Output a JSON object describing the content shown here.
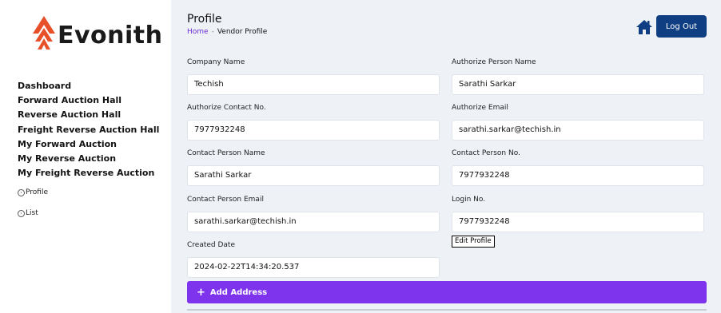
{
  "brand": {
    "name": "Evonith",
    "accent": "#e8502a"
  },
  "sidebar": {
    "items": [
      {
        "label": "Dashboard"
      },
      {
        "label": "Forward Auction Hall"
      },
      {
        "label": "Reverse Auction Hall"
      },
      {
        "label": "Freight Reverse Auction Hall"
      },
      {
        "label": "My Forward Auction"
      },
      {
        "label": "My Reverse Auction"
      },
      {
        "label": "My Freight Reverse Auction"
      }
    ],
    "sub_items": [
      {
        "label": "Profile"
      },
      {
        "label": "List"
      }
    ]
  },
  "header": {
    "title": "Profile",
    "breadcrumb": {
      "home": "Home",
      "separator": "-",
      "current": "Vendor Profile"
    },
    "logout_label": "Log Out"
  },
  "form": {
    "company_name": {
      "label": "Company Name",
      "value": "Techish"
    },
    "authorize_person_name": {
      "label": "Authorize Person Name",
      "value": "Sarathi Sarkar"
    },
    "authorize_contact_no": {
      "label": "Authorize Contact No.",
      "value": "7977932248"
    },
    "authorize_email": {
      "label": "Authorize Email",
      "value": "sarathi.sarkar@techish.in"
    },
    "contact_person_name": {
      "label": "Contact Person Name",
      "value": "Sarathi Sarkar"
    },
    "contact_person_no": {
      "label": "Contact Person No.",
      "value": "7977932248"
    },
    "contact_person_email": {
      "label": "Contact Person Email",
      "value": "sarathi.sarkar@techish.in"
    },
    "login_no": {
      "label": "Login No.",
      "value": "7977932248"
    },
    "created_date": {
      "label": "Created Date",
      "value": "2024-02-22T14:34:20.537"
    },
    "edit_profile_label": "Edit Profile",
    "add_address_label": "Add Address"
  },
  "colors": {
    "primary": "#0f3f82",
    "accent_purple": "#7d34ec",
    "link": "#6b2fd6"
  }
}
